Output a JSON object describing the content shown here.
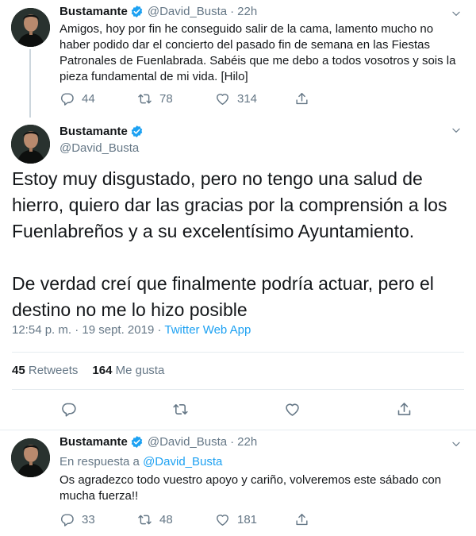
{
  "tweet1": {
    "name": "Bustamante",
    "handle": "@David_Busta",
    "dot": "·",
    "time": "22h",
    "text": "Amigos, hoy por fin he conseguido salir de la cama, lamento mucho no haber podido dar el concierto del pasado fin de semana en las Fiestas Patronales de Fuenlabrada. Sabéis que me debo a todos vosotros y sois la pieza fundamental de mi vida. [Hilo]",
    "replies": "44",
    "retweets": "78",
    "likes": "314"
  },
  "tweet2": {
    "name": "Bustamante",
    "handle": "@David_Busta",
    "paragraph1": "Estoy muy disgustado, pero no tengo una salud de hierro, quiero dar las gracias por la comprensión a los Fuenlabreños y a su excelentísimo Ayuntamiento.",
    "paragraph2": "De verdad creí que finalmente podría actuar, pero el destino no me lo hizo posible",
    "timestamp": "12:54 p. m. · 19 sept. 2019",
    "dot": " · ",
    "source": "Twitter Web App",
    "retweets_count": "45",
    "retweets_label": "Retweets",
    "likes_count": "164",
    "likes_label": "Me gusta"
  },
  "tweet3": {
    "name": "Bustamante",
    "handle": "@David_Busta",
    "dot": "·",
    "time": "22h",
    "reply_prefix": "En respuesta a",
    "reply_mention": "@David_Busta",
    "text": "Os agradezco todo vuestro apoyo y cariño, volveremos este sábado con mucha fuerza!!",
    "replies": "33",
    "retweets": "48",
    "likes": "181"
  },
  "colors": {
    "accent": "#1da1f2",
    "secondary_text": "#657786",
    "primary_text": "#14171a",
    "divider": "#e6ecf0"
  },
  "icons": [
    "verified-badge-icon",
    "reply-icon",
    "retweet-icon",
    "like-icon",
    "share-icon",
    "chevron-down-icon"
  ]
}
